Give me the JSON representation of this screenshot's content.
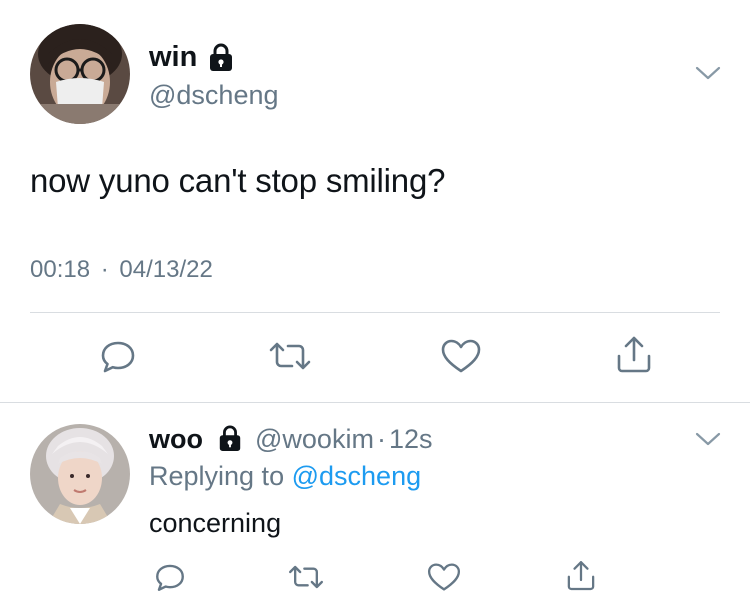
{
  "tweet": {
    "author_name": "win",
    "author_handle": "@dscheng",
    "text": "now yuno can't stop smiling?",
    "time": "00:18",
    "separator": "·",
    "date": "04/13/22"
  },
  "reply": {
    "author_name": "woo",
    "author_handle": "@wookim",
    "separator": "·",
    "age": "12s",
    "replying_prefix": "Replying to",
    "replying_to": "@dscheng",
    "text": "concerning"
  },
  "colors": {
    "text": "#0f1419",
    "secondary": "#657786",
    "link": "#1d9bf0",
    "divider": "#d9dde1"
  },
  "icons": {
    "lock": "lock-icon",
    "more": "chevron-down-icon",
    "reply": "reply-icon",
    "retweet": "retweet-icon",
    "like": "heart-icon",
    "share": "share-icon"
  }
}
